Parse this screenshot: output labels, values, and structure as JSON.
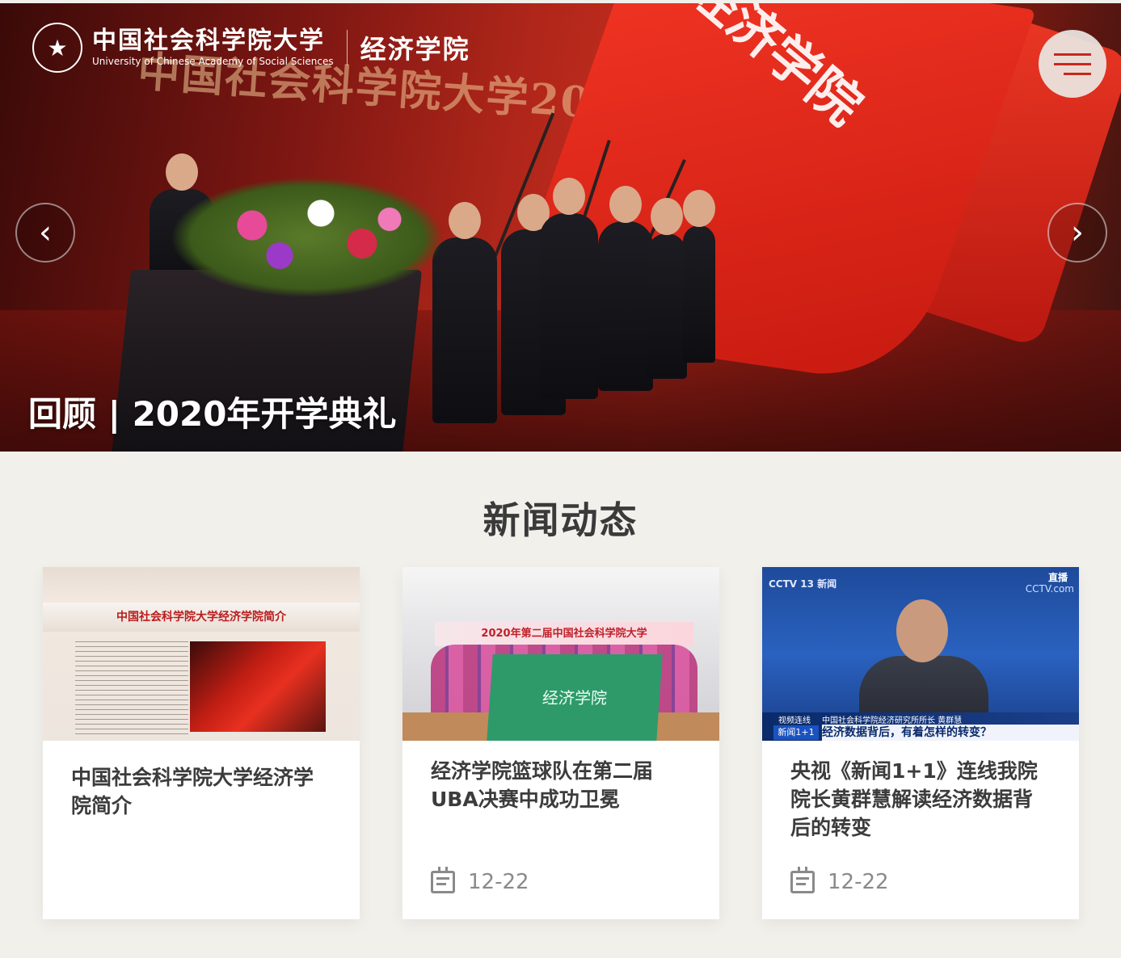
{
  "header": {
    "university_cn": "中国社会科学院大学",
    "university_en": "University of Chinese Academy of Social Sciences",
    "department": "经济学院"
  },
  "hero": {
    "caption": "回顾 | 2020年开学典礼",
    "background_banner_text": "中国社会科学院大学2020年开学",
    "flag_text": "经济学院",
    "prev_icon": "chevron-left-icon",
    "next_icon": "chevron-right-icon"
  },
  "news": {
    "section_title": "新闻动态",
    "items": [
      {
        "title": "中国社会科学院大学经济学院简介",
        "date": "",
        "thumb_heading": "中国社会科学院大学经济学院简介"
      },
      {
        "title": "经济学院篮球队在第二届UBA决赛中成功卫冕",
        "date": "12-22",
        "thumb_banner": "2020年第二届中国社会科学院大学",
        "thumb_flag": "经济学院"
      },
      {
        "title": "央视《新闻1+1》连线我院院长黄群慧解读经济数据背后的转变",
        "date": "12-22",
        "thumb_channel": "CCTV 13 新闻",
        "thumb_live": "直播",
        "thumb_site": "CCTV.com",
        "thumb_tag1": "视频连线",
        "thumb_tag2": "新闻1+1",
        "thumb_subtitle_name": "中国社会科学院经济研究所所长 黄群慧",
        "thumb_subtitle_title": "经济数据背后，有着怎样的转变？"
      }
    ]
  },
  "colors": {
    "accent_red": "#c8281c",
    "page_bg": "#f1f0eb",
    "title_text": "#3c3c3c"
  }
}
